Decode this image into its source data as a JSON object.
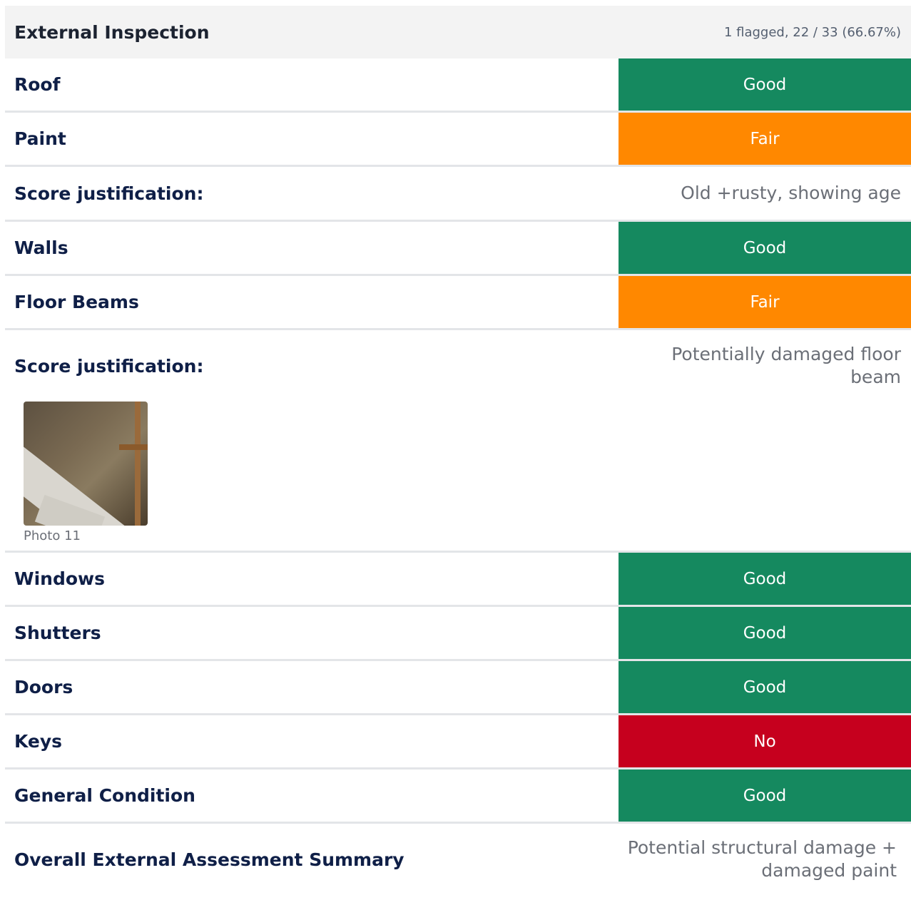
{
  "header": {
    "title": "External Inspection",
    "meta": "1 flagged, 22 / 33 (66.67%)"
  },
  "rows": {
    "roof": {
      "label": "Roof",
      "status": "Good"
    },
    "paint": {
      "label": "Paint",
      "status": "Fair"
    },
    "paint_note": {
      "label": "Score justification:",
      "note": "Old +rusty, showing age"
    },
    "walls": {
      "label": "Walls",
      "status": "Good"
    },
    "floor_beams": {
      "label": "Floor Beams",
      "status": "Fair"
    },
    "floor_note": {
      "label": "Score justification:",
      "note": "Potentially damaged floor beam",
      "photo_caption": "Photo 11"
    },
    "windows": {
      "label": "Windows",
      "status": "Good"
    },
    "shutters": {
      "label": "Shutters",
      "status": "Good"
    },
    "doors": {
      "label": "Doors",
      "status": "Good"
    },
    "keys": {
      "label": "Keys",
      "status": "No"
    },
    "general": {
      "label": "General Condition",
      "status": "Good"
    },
    "summary": {
      "label": "Overall External Assessment Summary",
      "note": "Potential structural damage + damaged paint"
    }
  },
  "colors": {
    "good": "#15895f",
    "fair": "#ff8800",
    "no": "#c6001e"
  }
}
